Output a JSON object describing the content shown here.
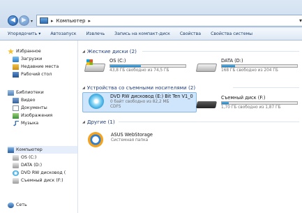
{
  "address": {
    "path": "Компьютер",
    "sep": "▸",
    "back": "◀",
    "forward": "▶",
    "drop": "▾"
  },
  "toolbar": {
    "organize": "Упорядочить ▾",
    "autorun": "Автозапуск",
    "eject": "Извлечь",
    "burn": "Запись на компакт-диск",
    "properties": "Свойства",
    "system_properties": "Свойства системы"
  },
  "sidebar": {
    "favorites": "Избранное",
    "downloads": "Загрузки",
    "recent": "Недавние места",
    "desktop": "Рабочий стол",
    "libraries": "Библиотеки",
    "video": "Видео",
    "documents": "Документы",
    "pictures": "Изображения",
    "music": "Музыка",
    "computer": "Компьютер",
    "os": "OS (C:)",
    "data": "DATA (D:)",
    "dvd": "DVD RW дисковод (",
    "removable": "Съемный диск (F:)",
    "network": "Сеть"
  },
  "groups": {
    "hard_drives": "Жесткие диски (2)",
    "removable": "Устройства со съемными носителями (2)",
    "other": "Другие (1)",
    "arrow": "◢"
  },
  "drives": {
    "c": {
      "name": "OS (C:)",
      "free": "43,8 ГБ свободно из 74,5 ГБ",
      "used_fraction": 0.41
    },
    "d": {
      "name": "DATA (D:)",
      "free": "168 ГБ свободно из 204 ГБ",
      "used_fraction": 0.18
    },
    "dvd": {
      "name": "DVD RW дисковод (E:) Bit Ten V1_0",
      "free": "0 байт свободно из 82,2 МБ",
      "fs": "CDFS"
    },
    "f": {
      "name": "Съемный диск (F:)",
      "free": "1,70 ГБ свободно из 1,87 ГБ",
      "used_fraction": 0.09
    }
  },
  "other": {
    "asus": {
      "name": "ASUS WebStorage",
      "desc": "Системная папка"
    }
  }
}
